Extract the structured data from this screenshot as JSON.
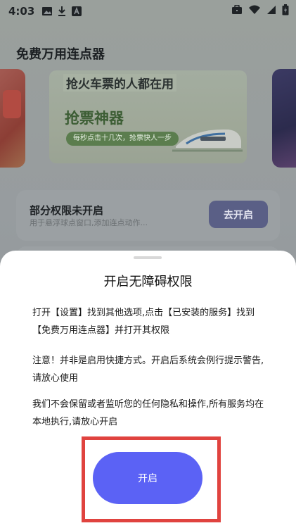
{
  "status_bar": {
    "time": "4:03",
    "icons": [
      "image-icon",
      "download-icon",
      "font-icon"
    ],
    "right_icons": [
      "briefcase-icon",
      "wifi-icon",
      "signal-icon",
      "battery-icon"
    ]
  },
  "app": {
    "title": "免费万用连点器",
    "banner": {
      "line1": "抢火车票的人都在用",
      "line2": "抢票神器",
      "pill": "每秒点击十几次，抢票快人一步"
    },
    "permission_card": {
      "title": "部分权限未开启",
      "subtitle": "用于悬浮球点窗口,添加连点动作...",
      "button": "去开启"
    }
  },
  "sheet": {
    "title": "开启无障碍权限",
    "paragraph1": "打开【设置】找到其他选项,点击【已安装的服务】找到【免费万用连点器】并打开其权限",
    "paragraph2": "注意！并非是启用快捷方式。开启后系统会例行提示警告,请放心使用",
    "paragraph3": "我们不会保留或者监听您的任何隐私和操作,所有服务均在本地执行,请放心开启",
    "button": "开启"
  },
  "colors": {
    "accent": "#5b62f5",
    "highlight": "#e0433f",
    "sheet_bg": "#ffffff"
  }
}
